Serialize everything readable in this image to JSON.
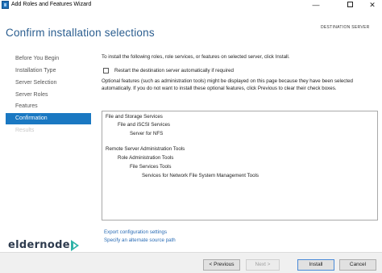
{
  "window": {
    "title": "Add Roles and Features Wizard",
    "minimize_glyph": "—",
    "close_glyph": "✕"
  },
  "header": {
    "page_title": "Confirm installation selections",
    "destination_label": "DESTINATION SERVER"
  },
  "nav": {
    "items": [
      {
        "label": "Before You Begin",
        "state": "normal"
      },
      {
        "label": "Installation Type",
        "state": "normal"
      },
      {
        "label": "Server Selection",
        "state": "normal"
      },
      {
        "label": "Server Roles",
        "state": "normal"
      },
      {
        "label": "Features",
        "state": "normal"
      },
      {
        "label": "Confirmation",
        "state": "active"
      },
      {
        "label": "Results",
        "state": "disabled"
      }
    ]
  },
  "content": {
    "intro": "To install the following roles, role services, or features on selected server, click Install.",
    "restart_checkbox": {
      "label": "Restart the destination server automatically if required",
      "checked": false
    },
    "note": "Optional features (such as administration tools) might be displayed on this page because they have been selected automatically. If you do not want to install these optional features, click Previous to clear their check boxes.",
    "selections": [
      {
        "text": "File and Storage Services",
        "level": 0
      },
      {
        "text": "File and iSCSI Services",
        "level": 1
      },
      {
        "text": "Server for NFS",
        "level": 2
      },
      {
        "text": "Remote Server Administration Tools",
        "level": 0
      },
      {
        "text": "Role Administration Tools",
        "level": 1
      },
      {
        "text": "File Services Tools",
        "level": 2
      },
      {
        "text": "Services for Network File System Management Tools",
        "level": 3
      }
    ],
    "links": {
      "export": "Export configuration settings",
      "alternate_source": "Specify an alternate source path"
    }
  },
  "footer": {
    "previous": "< Previous",
    "next": "Next >",
    "install": "Install",
    "cancel": "Cancel"
  },
  "watermark": {
    "brand": "eldernode"
  },
  "colors": {
    "accent": "#1a78c2",
    "title_blue": "#2a5d8f",
    "link_blue": "#2a6cb5"
  }
}
